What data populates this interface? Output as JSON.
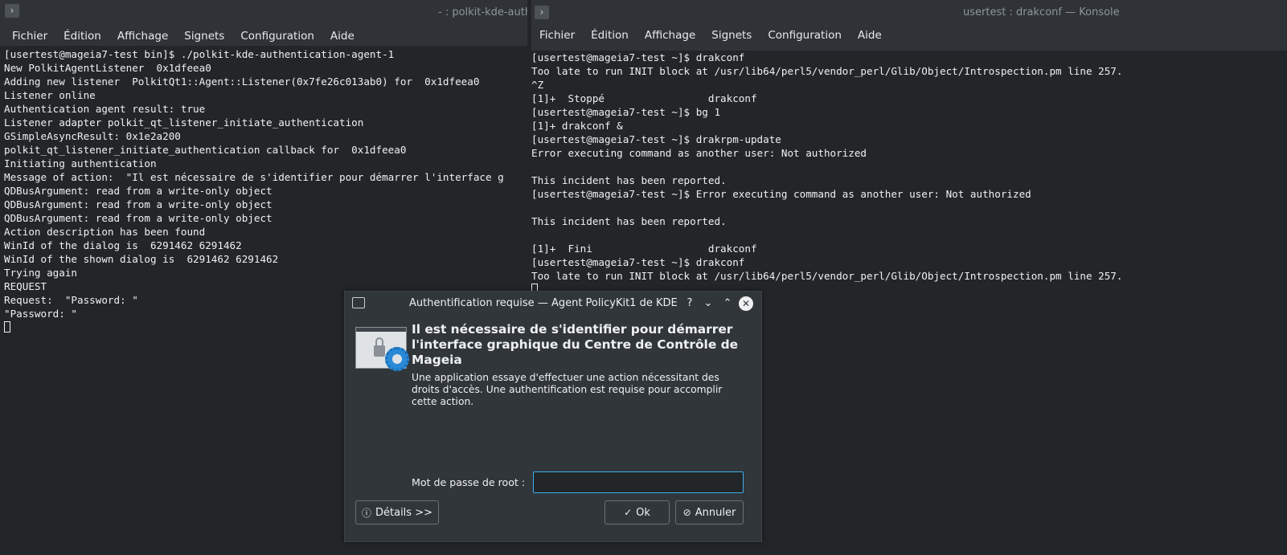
{
  "left_window": {
    "title": "- : polkit-kde-auth",
    "menu": [
      "Fichier",
      "Édition",
      "Affichage",
      "Signets",
      "Configuration",
      "Aide"
    ],
    "lines": [
      "[usertest@mageia7-test bin]$ ./polkit-kde-authentication-agent-1",
      "New PolkitAgentListener  0x1dfeea0",
      "Adding new listener  PolkitQt1::Agent::Listener(0x7fe26c013ab0) for  0x1dfeea0",
      "Listener online",
      "Authentication agent result: true",
      "Listener adapter polkit_qt_listener_initiate_authentication",
      "GSimpleAsyncResult: 0x1e2a200",
      "polkit_qt_listener_initiate_authentication callback for  0x1dfeea0",
      "Initiating authentication",
      "Message of action:  \"Il est nécessaire de s'identifier pour démarrer l'interface g",
      "QDBusArgument: read from a write-only object",
      "QDBusArgument: read from a write-only object",
      "QDBusArgument: read from a write-only object",
      "Action description has been found",
      "WinId of the dialog is  6291462 6291462",
      "WinId of the shown dialog is  6291462 6291462",
      "Trying again",
      "REQUEST",
      "Request:  \"Password: \"",
      "\"Password: \""
    ]
  },
  "right_window": {
    "title": "usertest : drakconf — Konsole",
    "menu": [
      "Fichier",
      "Édition",
      "Affichage",
      "Signets",
      "Configuration",
      "Aide"
    ],
    "lines": [
      "[usertest@mageia7-test ~]$ drakconf",
      "Too late to run INIT block at /usr/lib64/perl5/vendor_perl/Glib/Object/Introspection.pm line 257.",
      "^Z",
      "[1]+  Stoppé                 drakconf",
      "[usertest@mageia7-test ~]$ bg 1",
      "[1]+ drakconf &",
      "[usertest@mageia7-test ~]$ drakrpm-update",
      "Error executing command as another user: Not authorized",
      "",
      "This incident has been reported.",
      "[usertest@mageia7-test ~]$ Error executing command as another user: Not authorized",
      "",
      "This incident has been reported.",
      "",
      "[1]+  Fini                   drakconf",
      "[usertest@mageia7-test ~]$ drakconf",
      "Too late to run INIT block at /usr/lib64/perl5/vendor_perl/Glib/Object/Introspection.pm line 257."
    ]
  },
  "dialog": {
    "title": "Authentification requise — Agent PolicyKit1 de KDE",
    "heading": "Il est nécessaire de s'identifier pour démarrer l'interface graphique du Centre de Contrôle de Mageia",
    "body": "Une application essaye d'effectuer une action nécessitant des droits d'accès. Une authentification est requise pour accomplir cette action.",
    "password_label": "Mot de passe de root :",
    "password_value": "",
    "details_label": "Détails >>",
    "ok_label": "Ok",
    "cancel_label": "Annuler",
    "titlebar_buttons": {
      "help": "?",
      "minimize": "⌄",
      "maximize": "⌃",
      "close": "✕"
    }
  },
  "colors": {
    "accent": "#3daee9",
    "terminal_bg": "#232629",
    "dialog_bg": "#31363b"
  }
}
